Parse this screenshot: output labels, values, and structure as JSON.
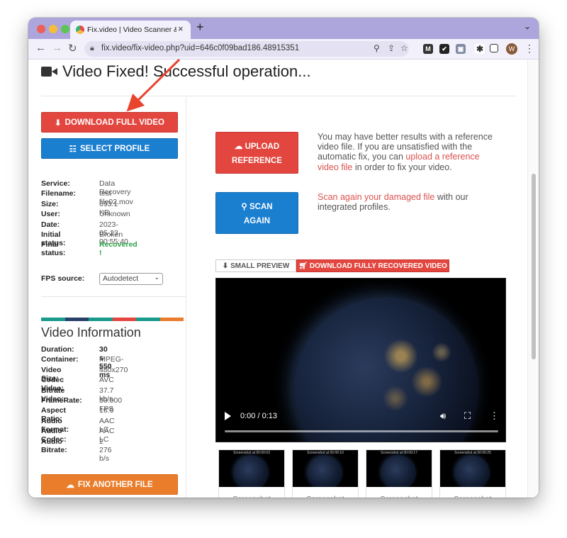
{
  "browser": {
    "tab_title": "Fix.video | Video Scanner & Fix",
    "tab_close": "×",
    "new_tab": "+",
    "tab_dropdown": "⌄",
    "url": "fix.video/fix-video.php?uid=646c0f09bad186.48915351",
    "profile_initial": "W",
    "extensions": [
      {
        "name": "mail-extension",
        "glyph": "M",
        "color": "#333333"
      },
      {
        "name": "checklist-extension",
        "glyph": "✔",
        "color": "#222222"
      },
      {
        "name": "image-extension",
        "glyph": "▣",
        "color": "#7f8aa3"
      }
    ]
  },
  "page": {
    "title": "Video Fixed! Successful operation..."
  },
  "left": {
    "download_btn": "DOWNLOAD FULL VIDEO",
    "select_profile_btn": "SELECT PROFILE",
    "info": [
      {
        "key": "Service:",
        "value": "Data Recovery",
        "style": "normal"
      },
      {
        "key": "Filename:",
        "value": "test file02.mov",
        "style": "normal"
      },
      {
        "key": "Size:",
        "value": "693.1 KB",
        "style": "normal"
      },
      {
        "key": "User:",
        "value": "Unknown",
        "style": "normal"
      },
      {
        "key": "Date:",
        "value": "2023-05-23 00:55:40",
        "style": "normal"
      },
      {
        "key": "Initial status:",
        "value": "Broken",
        "style": "normal"
      },
      {
        "key": "Final status:",
        "value": "Recovered !",
        "style": "green"
      }
    ],
    "fps_label": "FPS source:",
    "fps_value": "Autodetect",
    "stripe_colors": [
      "#1a9a8c",
      "#28416b",
      "#1a9a8c",
      "#e3463f",
      "#1a9a8c",
      "#ea7d2c"
    ],
    "video_info_title": "Video Information",
    "video_info": [
      {
        "key": "Duration:",
        "value": "30 s 550 ms",
        "style": "bold"
      },
      {
        "key": "Container:",
        "value": "MPEG-4",
        "style": "normal"
      },
      {
        "key": "Video Size:",
        "value": "480x270",
        "style": "normal"
      },
      {
        "key": "Codec Video:",
        "value": "AVC",
        "style": "normal"
      },
      {
        "key": "Bitrate Video:",
        "value": "37.7 kb/s",
        "style": "normal"
      },
      {
        "key": "FrameRate:",
        "value": "30.000 FPS",
        "style": "normal"
      },
      {
        "key": "Aspect Ratio:",
        "value": "16:9",
        "style": "normal"
      },
      {
        "key": "Audio Format:",
        "value": "AAC LC",
        "style": "normal"
      },
      {
        "key": "Audio Codec:",
        "value": "AAC LC",
        "style": "normal"
      },
      {
        "key": "Audio Bitrate:",
        "value": "2 276 b/s",
        "style": "normal"
      }
    ],
    "fix_another_btn": "FIX ANOTHER FILE"
  },
  "right": {
    "upload_btn_line1": "UPLOAD",
    "upload_btn_line2": "REFERENCE",
    "upload_text_1": "You may have better results with a reference video file. If you are unsatisfied with the automatic fix, you can ",
    "upload_link": "upload a reference video file",
    "upload_text_2": " in order to fix your video.",
    "scan_btn_line1": "SCAN",
    "scan_btn_line2": "AGAIN",
    "scan_link": "Scan again your damaged file",
    "scan_text": " with our integrated profiles.",
    "tab_small_preview": "SMALL PREVIEW",
    "tab_download_recovered": "DOWNLOAD FULLY RECOVERED VIDEO",
    "video_time": "0:00 / 0:13",
    "video_progress": 0.0,
    "screenshots": [
      {
        "caption": "Screenshot at 00:00:03",
        "label1": "Screenshot",
        "label2": "N°1"
      },
      {
        "caption": "Screenshot at 00:00:10",
        "label1": "Screenshot",
        "label2": "N°2"
      },
      {
        "caption": "Screenshot at 00:00:17",
        "label1": "Screenshot",
        "label2": "N°3"
      },
      {
        "caption": "Screenshot at 00:00:25",
        "label1": "Screenshot",
        "label2": "N°4"
      }
    ]
  },
  "colors": {
    "accent_red": "#e3463f",
    "accent_blue": "#1b7fd0",
    "accent_orange": "#ea7d2c",
    "success_green": "#2ea34a",
    "link_red": "#d9534f",
    "annotation_arrow": "#e8442e"
  }
}
